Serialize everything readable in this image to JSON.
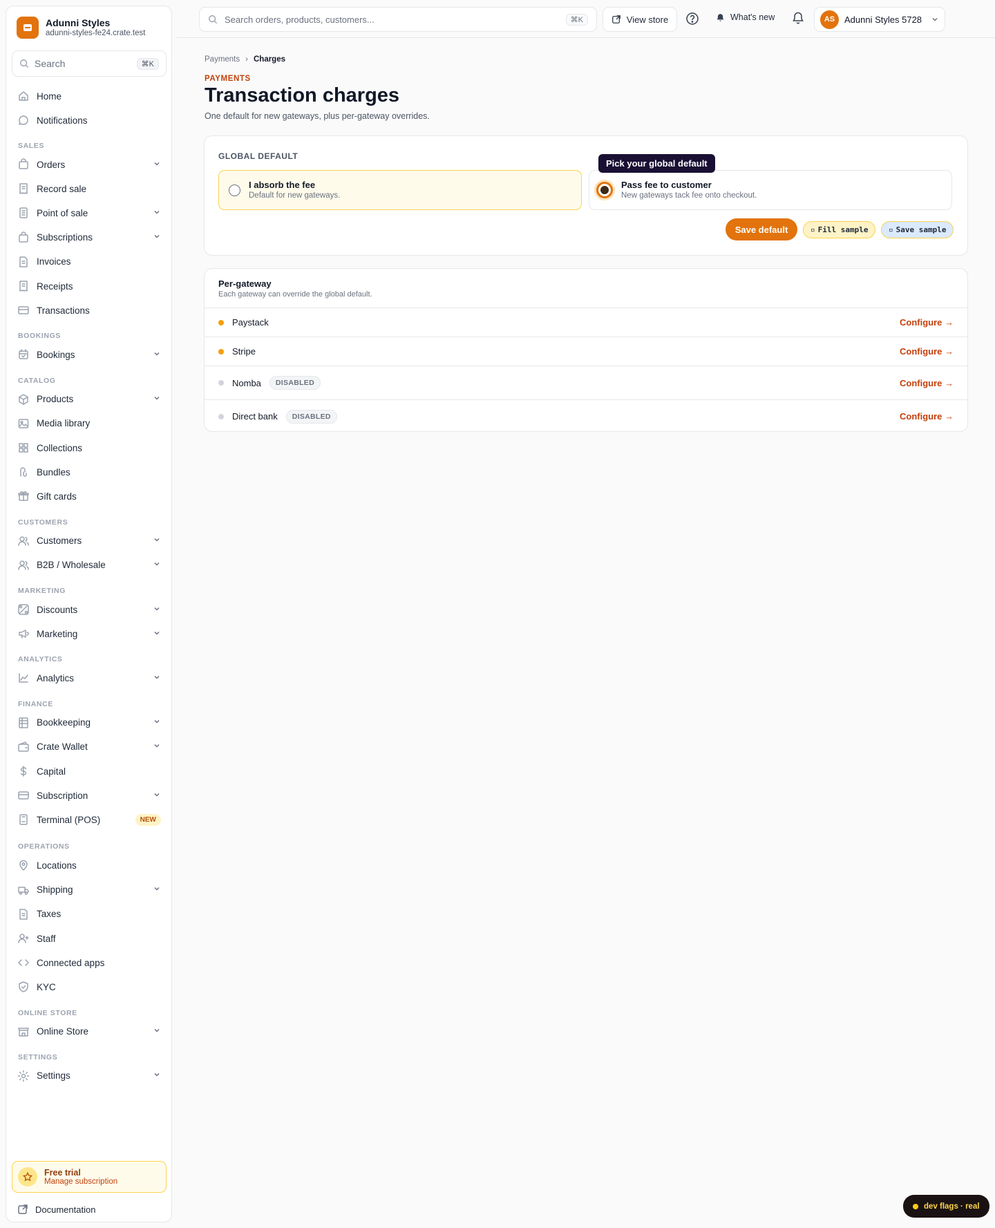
{
  "brand": {
    "name": "Adunni Styles",
    "domain": "adunni-styles-fe24.crate.test"
  },
  "sidebar": {
    "search_placeholder": "Search",
    "search_kbd": "⌘K",
    "items": [
      {
        "label": "Home",
        "icon": "home-icon",
        "chev": false
      },
      {
        "label": "Notifications",
        "icon": "message-icon",
        "chev": false
      }
    ],
    "sections": [
      {
        "title": "SALES",
        "items": [
          {
            "label": "Orders",
            "icon": "bag-icon",
            "chev": true
          },
          {
            "label": "Record sale",
            "icon": "receipt-icon",
            "chev": false
          },
          {
            "label": "Point of sale",
            "icon": "pos-icon",
            "chev": true
          },
          {
            "label": "Subscriptions",
            "icon": "bag-icon",
            "chev": true
          },
          {
            "label": "Invoices",
            "icon": "file-icon",
            "chev": false
          },
          {
            "label": "Receipts",
            "icon": "receipt-icon",
            "chev": false
          },
          {
            "label": "Transactions",
            "icon": "card-icon",
            "chev": false
          }
        ]
      },
      {
        "title": "BOOKINGS",
        "items": [
          {
            "label": "Bookings",
            "icon": "calendar-icon",
            "chev": true
          }
        ]
      },
      {
        "title": "CATALOG",
        "items": [
          {
            "label": "Products",
            "icon": "box-icon",
            "chev": true
          },
          {
            "label": "Media library",
            "icon": "image-icon",
            "chev": false
          },
          {
            "label": "Collections",
            "icon": "grid-icon",
            "chev": false
          },
          {
            "label": "Bundles",
            "icon": "bundle-icon",
            "chev": false
          },
          {
            "label": "Gift cards",
            "icon": "gift-icon",
            "chev": false
          }
        ]
      },
      {
        "title": "CUSTOMERS",
        "items": [
          {
            "label": "Customers",
            "icon": "users-icon",
            "chev": true
          },
          {
            "label": "B2B / Wholesale",
            "icon": "users-icon",
            "chev": true
          }
        ]
      },
      {
        "title": "MARKETING",
        "items": [
          {
            "label": "Discounts",
            "icon": "discount-icon",
            "chev": true
          },
          {
            "label": "Marketing",
            "icon": "megaphone-icon",
            "chev": true
          }
        ]
      },
      {
        "title": "ANALYTICS",
        "items": [
          {
            "label": "Analytics",
            "icon": "chart-icon",
            "chev": true
          }
        ]
      },
      {
        "title": "FINANCE",
        "items": [
          {
            "label": "Bookkeeping",
            "icon": "ledger-icon",
            "chev": true
          },
          {
            "label": "Crate Wallet",
            "icon": "wallet-icon",
            "chev": true
          },
          {
            "label": "Capital",
            "icon": "dollar-icon",
            "chev": false
          },
          {
            "label": "Subscription",
            "icon": "card-icon",
            "chev": true
          },
          {
            "label": "Terminal (POS)",
            "icon": "terminal-icon",
            "chev": false,
            "badge": "NEW"
          }
        ]
      },
      {
        "title": "OPERATIONS",
        "items": [
          {
            "label": "Locations",
            "icon": "pin-icon",
            "chev": false
          },
          {
            "label": "Shipping",
            "icon": "truck-icon",
            "chev": true
          },
          {
            "label": "Taxes",
            "icon": "file-icon",
            "chev": false
          },
          {
            "label": "Staff",
            "icon": "user-plus-icon",
            "chev": false
          },
          {
            "label": "Connected apps",
            "icon": "code-icon",
            "chev": false
          },
          {
            "label": "KYC",
            "icon": "shield-icon",
            "chev": false
          }
        ]
      },
      {
        "title": "ONLINE STORE",
        "items": [
          {
            "label": "Online Store",
            "icon": "store-icon",
            "chev": true
          }
        ]
      },
      {
        "title": "SETTINGS",
        "items": [
          {
            "label": "Settings",
            "icon": "gear-icon",
            "chev": true
          }
        ]
      }
    ],
    "trial": {
      "title": "Free trial",
      "subtitle": "Manage subscription"
    },
    "documentation": "Documentation"
  },
  "topbar": {
    "search_placeholder": "Search orders, products, customers...",
    "search_kbd": "⌘K",
    "view_store": "View store",
    "whats_new": "What's new",
    "avatar_initials": "AS",
    "account_name": "Adunni Styles 5728"
  },
  "breadcrumb": {
    "parent": "Payments",
    "separator": "›",
    "current": "Charges"
  },
  "page": {
    "eyebrow": "PAYMENTS",
    "title": "Transaction charges",
    "subtitle": "One default for new gateways, plus per-gateway overrides."
  },
  "global_default": {
    "label": "GLOBAL DEFAULT",
    "tooltip": "Pick your global default",
    "options": [
      {
        "title": "I absorb the fee",
        "desc": "Default for new gateways."
      },
      {
        "title": "Pass fee to customer",
        "desc": "New gateways tack fee onto checkout."
      }
    ],
    "save_label": "Save default",
    "fill_sample": "Fill sample",
    "save_sample": "Save sample"
  },
  "per_gateway": {
    "title": "Per-gateway",
    "subtitle": "Each gateway can override the global default.",
    "rows": [
      {
        "name": "Paystack",
        "status": "",
        "action": "Configure →"
      },
      {
        "name": "Stripe",
        "status": "",
        "action": "Configure →"
      },
      {
        "name": "Nomba",
        "status": "DISABLED",
        "action": "Configure →"
      },
      {
        "name": "Direct bank",
        "status": "DISABLED",
        "action": "Configure →"
      }
    ]
  },
  "dev_flags": "dev flags · real",
  "colors": {
    "accent": "#e2730d",
    "tooltip_bg": "#1a1033",
    "active_dot": "#f59e0b",
    "inactive_dot": "#d1d5db"
  }
}
